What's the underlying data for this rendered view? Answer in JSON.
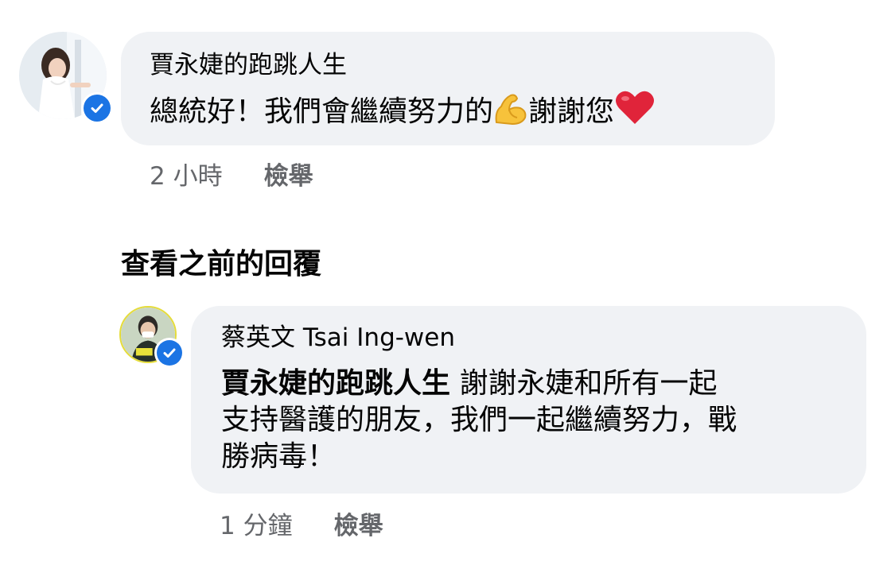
{
  "comment1": {
    "author": "賈永婕的跑跳人生",
    "text": "總統好！我們會繼續努力的",
    "text_after_emoji": "謝謝您",
    "emojis": [
      "flexed-biceps",
      "red-heart"
    ],
    "time": "2 小時",
    "report_label": "檢舉"
  },
  "view_previous_label": "查看之前的回覆",
  "reply1": {
    "author": "蔡英文 Tsai Ing-wen",
    "mention": "賈永婕的跑跳人生",
    "line1": " 謝謝永婕和所有一起",
    "line2": "支持醫護的朋友，我們一起繼續努力，戰",
    "line3": "勝病毒！",
    "time": "1 分鐘",
    "report_label": "檢舉"
  },
  "colors": {
    "bubble_bg": "#f0f2f5",
    "meta_text": "#65676b",
    "verified_blue": "#1b74e4"
  }
}
